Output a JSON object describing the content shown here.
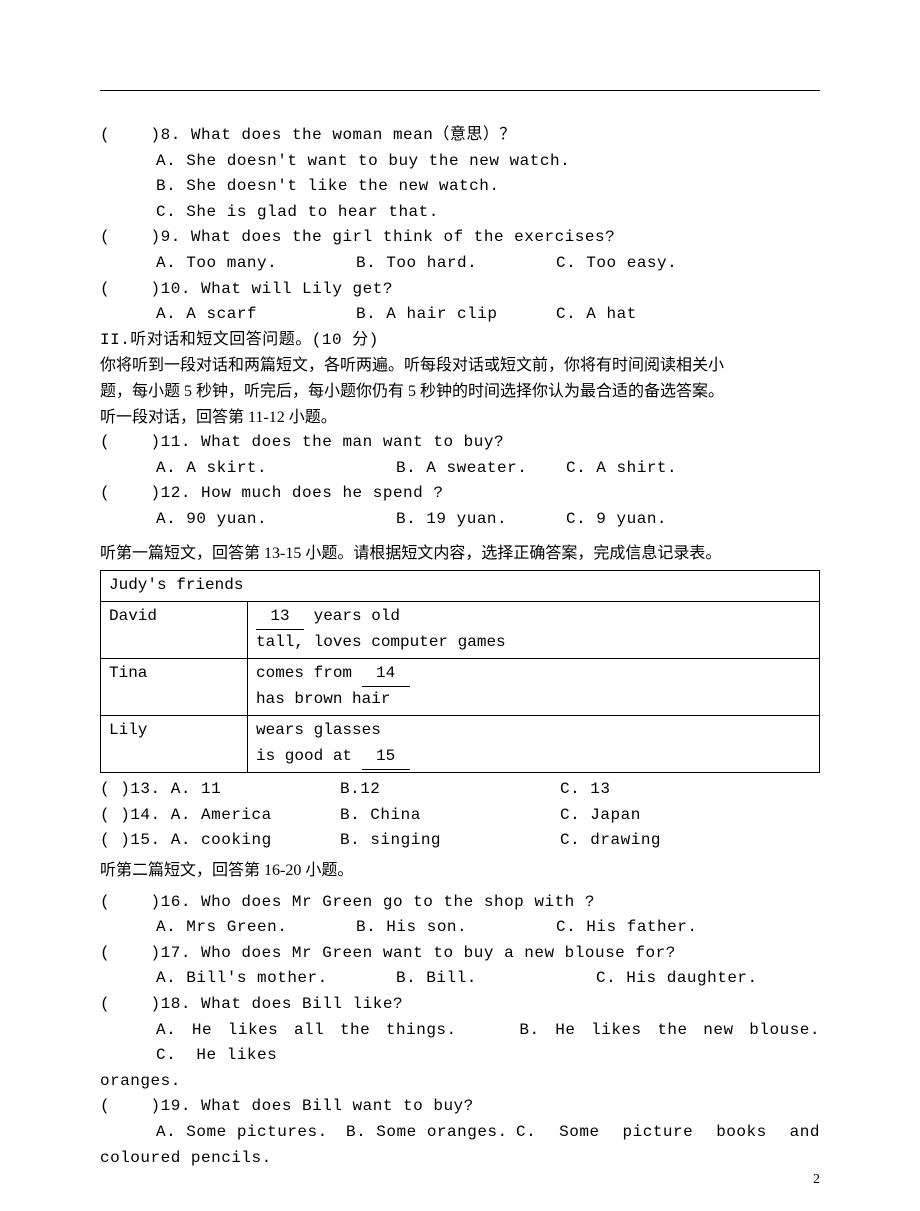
{
  "q8": {
    "prefix": "(    )8. ",
    "text": "What does the woman mean（意思）？",
    "A": "A. She doesn't want to buy the new watch.",
    "B": "B. She doesn't like the new watch.",
    "C": "C. She is glad to hear that."
  },
  "q9": {
    "prefix": "(    )9. ",
    "text": "What does the girl think of the exercises?",
    "A": "A. Too many.",
    "B": "B. Too hard.",
    "C": "C. Too easy."
  },
  "q10": {
    "prefix": "(    )10. ",
    "text": "What will Lily get?",
    "A": "A. A scarf",
    "B": "B. A hair clip",
    "C": "C. A hat"
  },
  "sectionII": "II.听对话和短文回答问题。(10 分)",
  "para1_line1": "你将听到一段对话和两篇短文，各听两遍。听每段对话或短文前，你将有时间阅读相关小",
  "para1_line2": "题，每小题 5 秒钟，听完后，每小题你仍有 5 秒钟的时间选择你认为最合适的备选答案。",
  "para2": "听一段对话，回答第 11-12 小题。",
  "q11": {
    "prefix": "(    )11. ",
    "text": "What does the man want to buy?",
    "A": "A. A skirt.",
    "B": "B. A sweater.",
    "C": "C. A shirt."
  },
  "q12": {
    "prefix": "(    )12. ",
    "text": "How much does he spend ?",
    "A": "A. 90 yuan.",
    "B": "B. 19 yuan.",
    "C": "C. 9 yuan."
  },
  "para3": "听第一篇短文，回答第 13-15 小题。请根据短文内容，选择正确答案，完成信息记录表。",
  "table": {
    "header": "Judy's friends",
    "rows": {
      "r1": {
        "name": "David",
        "line1pre": " ",
        "line1blank": "  13  ",
        "line1post": "  years old",
        "line2": "tall, loves computer games"
      },
      "r2": {
        "name": "Tina",
        "line1pre": "comes from ",
        "line1blank": "  14  ",
        "line1post": "",
        "line2": "has brown hair"
      },
      "r3": {
        "name": "Lily",
        "line1": "wears glasses",
        "line2pre": "is good at ",
        "line2blank": "  15  ",
        "line2post": ""
      }
    }
  },
  "q13": {
    "prefix": "(    )13. ",
    "A": "A. 11",
    "B": "B.12",
    "C": "C. 13"
  },
  "q14": {
    "prefix": "(    )14. ",
    "A": "A. America",
    "B": "B. China",
    "C": "C. Japan"
  },
  "q15": {
    "prefix": "(    )15. ",
    "A": "A. cooking",
    "B": "B. singing",
    "C": "C. drawing"
  },
  "para4": "听第二篇短文，回答第 16-20 小题。",
  "q16": {
    "prefix": "(    )16. ",
    "text": "Who does Mr Green go to the shop with ?",
    "A": "A. Mrs Green.",
    "B": "B. His son.",
    "C": "C. His father."
  },
  "q17": {
    "prefix": "(    )17. ",
    "text": "Who does Mr Green want to buy a new blouse for?",
    "A": "A. Bill's mother.",
    "B": "B. Bill.",
    "C": "C. His daughter."
  },
  "q18": {
    "prefix": "(    )18. ",
    "text": "What does Bill like?",
    "line2": "A. He likes all the things.    B. He likes the new blouse.      C.  He likes",
    "tail": "oranges."
  },
  "q19": {
    "prefix": "(    )19. ",
    "text": "What does Bill want to buy?",
    "A": "A. Some pictures.",
    "B": "B. Some oranges.",
    "Cparts": [
      "C.",
      "Some",
      "picture",
      "books",
      "and"
    ],
    "tail": "coloured pencils."
  },
  "page_number": "2"
}
